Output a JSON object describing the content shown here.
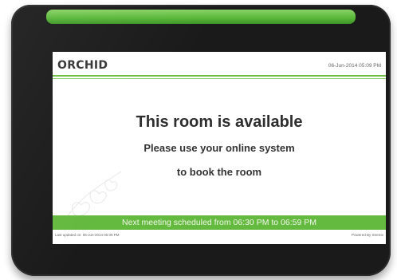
{
  "device": {
    "bezel_color": "#1a1a1a",
    "led_color": "#6dc94a"
  },
  "header": {
    "logo_text": "ORCHID",
    "datetime": "06-Jun-2014 05:09 PM",
    "accent_color": "#6dbf45"
  },
  "main": {
    "headline": "This room is available",
    "message_line1": "Please use your online system",
    "message_line2": "to book the room"
  },
  "banner": {
    "text": "Next meeting scheduled from 06:30 PM to 06:59 PM",
    "color": "#64b93f"
  },
  "footer": {
    "last_updated": "Last updated on: 06-Jun-2014 05:09 PM",
    "powered_by": "Powered By Streme"
  },
  "icons": {
    "watermark": "orchid-flower-icon"
  }
}
